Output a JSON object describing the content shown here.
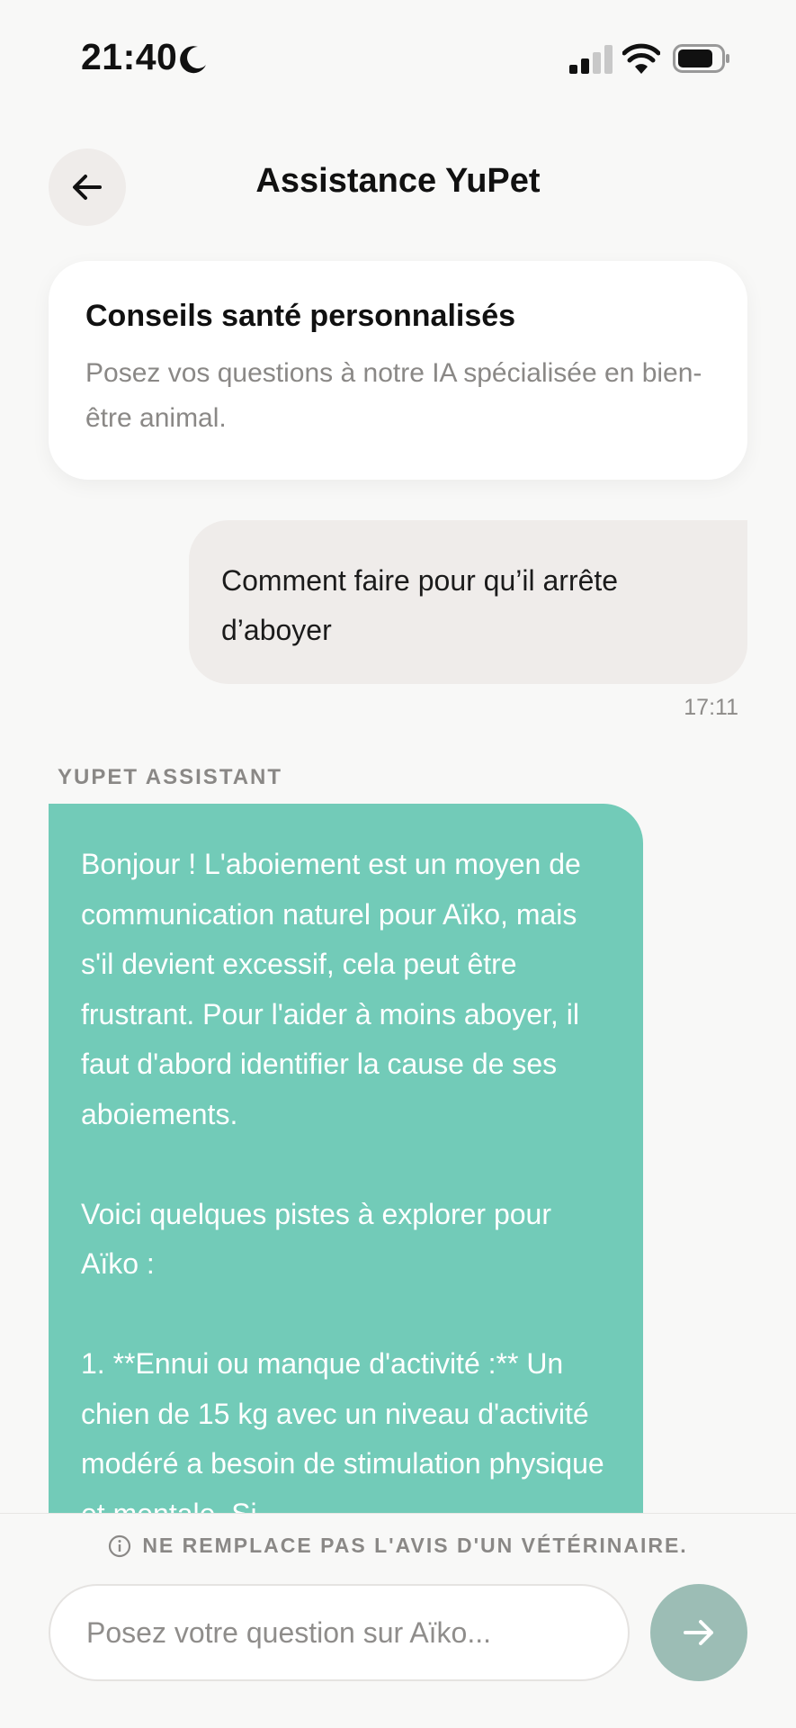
{
  "status_bar": {
    "time": "21:40",
    "icons": [
      "moon-icon",
      "signal-icon",
      "wifi-icon",
      "battery-icon"
    ]
  },
  "header": {
    "title": "Assistance YuPet",
    "back_icon": "arrow-left-icon"
  },
  "info_card": {
    "title": "Conseils santé personnalisés",
    "description": "Posez vos questions à notre IA spécialisée en bien-être animal."
  },
  "messages": {
    "user": {
      "text": "Comment faire pour qu’il arrête d’aboyer",
      "time": "17:11"
    },
    "assistant": {
      "label": "YUPET ASSISTANT",
      "text": "Bonjour ! L'aboiement est un moyen de communication naturel pour Aïko, mais s'il devient excessif, cela peut être frustrant. Pour l'aider à moins aboyer, il faut d'abord identifier la cause de ses aboiements.\n\nVoici quelques pistes à explorer pour Aïko :\n\n1.  **Ennui ou manque d'activité :** Un chien de 15 kg avec un niveau d'activité modéré a besoin de stimulation physique et mentale. Si"
    }
  },
  "footer": {
    "disclaimer": "NE REMPLACE PAS L'AVIS D'UN VÉTÉRINAIRE.",
    "input_placeholder": "Posez votre question sur Aïko...",
    "send_icon": "arrow-right-icon"
  },
  "colors": {
    "accent": "#72cbb8",
    "send_button": "#9cbdb5",
    "user_bubble": "#efecea",
    "background": "#f8f8f7"
  }
}
